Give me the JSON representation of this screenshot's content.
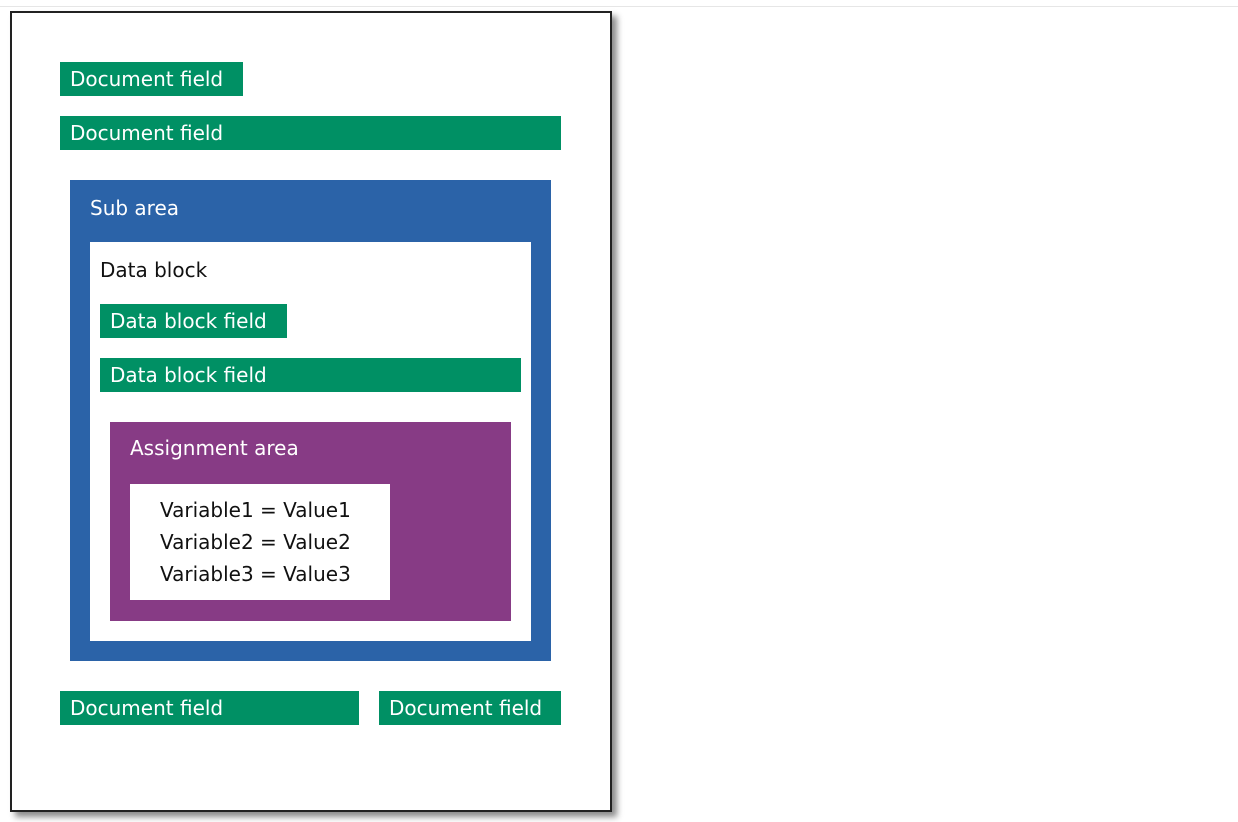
{
  "colors": {
    "field_green": "#009064",
    "sub_area_blue": "#2B63A8",
    "assignment_purple": "#873B85",
    "page_border": "#222222"
  },
  "document_fields": {
    "top_short": "Document field",
    "top_wide": "Document field",
    "bottom_left": "Document field",
    "bottom_right": "Document field"
  },
  "sub_area": {
    "title": "Sub area",
    "data_block": {
      "title": "Data block",
      "fields": [
        "Data block field",
        "Data block field"
      ],
      "assignment_area": {
        "title": "Assignment area",
        "lines": [
          "Variable1 = Value1",
          "Variable2 = Value2",
          "Variable3 = Value3"
        ]
      }
    }
  }
}
